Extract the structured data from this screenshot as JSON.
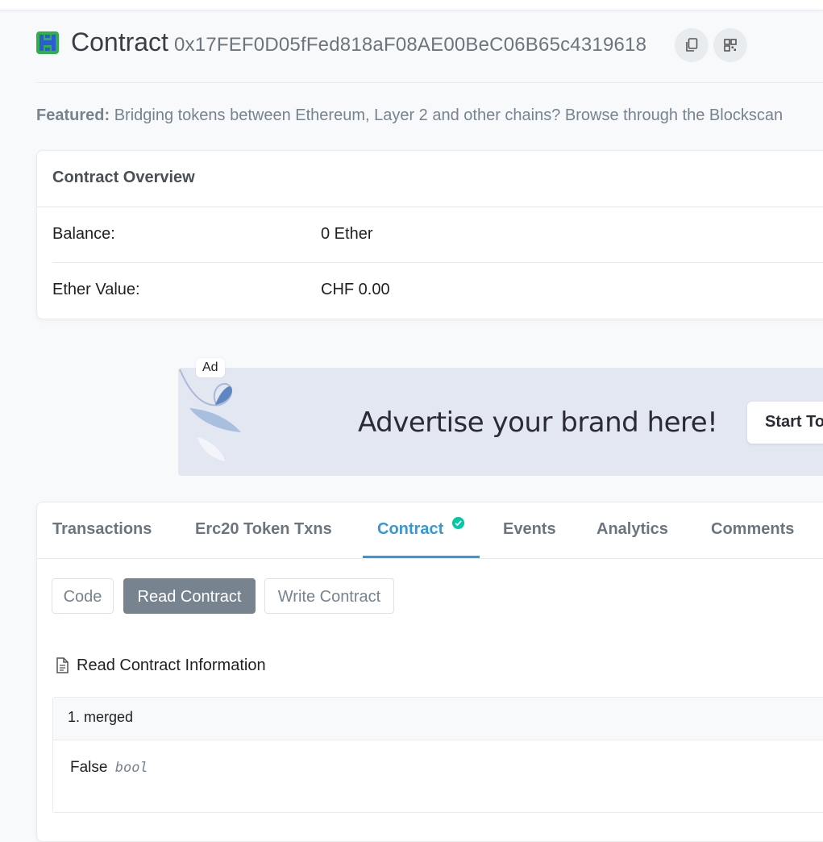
{
  "header": {
    "title": "Contract",
    "address": "0x17FEF0D05fFed818aF08AE00BeC06B65c4319618",
    "copy_icon": "copy-icon",
    "qr_icon": "qr-code-icon"
  },
  "featured": {
    "label": "Featured:",
    "text": "Bridging tokens between Ethereum, Layer 2 and other chains? Browse through the Blockscan"
  },
  "overview": {
    "title": "Contract Overview",
    "rows": [
      {
        "label": "Balance:",
        "value": "0 Ether"
      },
      {
        "label": "Ether Value:",
        "value": "CHF 0.00"
      }
    ]
  },
  "ad": {
    "label": "Ad",
    "headline": "Advertise your brand here!",
    "button": "Start To"
  },
  "tabs": [
    {
      "label": "Transactions",
      "active": false
    },
    {
      "label": "Erc20 Token Txns",
      "active": false
    },
    {
      "label": "Contract",
      "active": true,
      "verified": true
    },
    {
      "label": "Events",
      "active": false
    },
    {
      "label": "Analytics",
      "active": false
    },
    {
      "label": "Comments",
      "active": false
    }
  ],
  "contract_tabs": [
    {
      "label": "Code",
      "active": false
    },
    {
      "label": "Read Contract",
      "active": true
    },
    {
      "label": "Write Contract",
      "active": false
    }
  ],
  "read_section": {
    "title": "Read Contract Information",
    "icon": "document-icon"
  },
  "functions": [
    {
      "name": "1. merged",
      "value": "False",
      "type": "bool"
    }
  ],
  "colors": {
    "accent": "#3498db",
    "verified": "#00c9a7",
    "active_button": "#77838f"
  }
}
